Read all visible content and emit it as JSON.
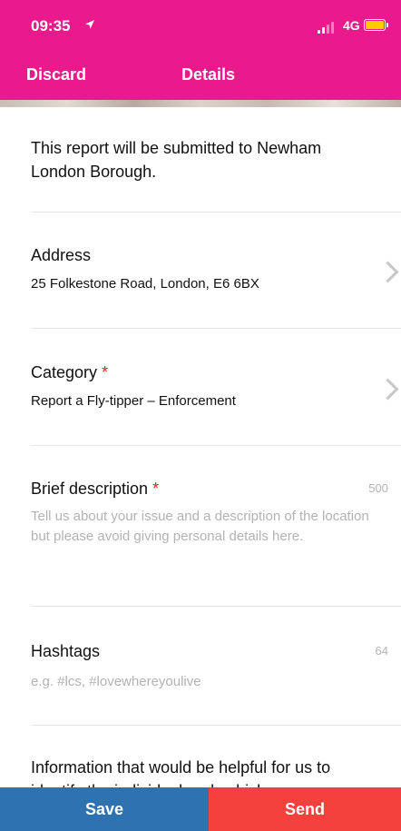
{
  "status_bar": {
    "time": "09:35",
    "location_icon": "location-arrow-icon",
    "network": "4G",
    "battery_color": "#ffcc00"
  },
  "nav": {
    "discard_label": "Discard",
    "title": "Details",
    "background_color": "#ea1a8c"
  },
  "intro": {
    "text": "This report will be submitted to Newham London Borough."
  },
  "address": {
    "label": "Address",
    "value": "25 Folkestone Road, London, E6 6BX"
  },
  "category": {
    "label": "Category",
    "required_mark": "*",
    "value": "Report a Fly-tipper – Enforcement"
  },
  "description": {
    "label": "Brief description",
    "required_mark": "*",
    "counter": "500",
    "placeholder": "Tell us about your issue and a description of the location but please avoid giving personal details here."
  },
  "hashtags": {
    "label": "Hashtags",
    "counter": "64",
    "placeholder": "e.g. #lcs, #lovewhereyoulive"
  },
  "info": {
    "text": "Information that would be helpful for us to identify the individual and vehicle"
  },
  "actions": {
    "save_label": "Save",
    "send_label": "Send",
    "save_color": "#2f72b0",
    "send_color": "#f4413d"
  }
}
